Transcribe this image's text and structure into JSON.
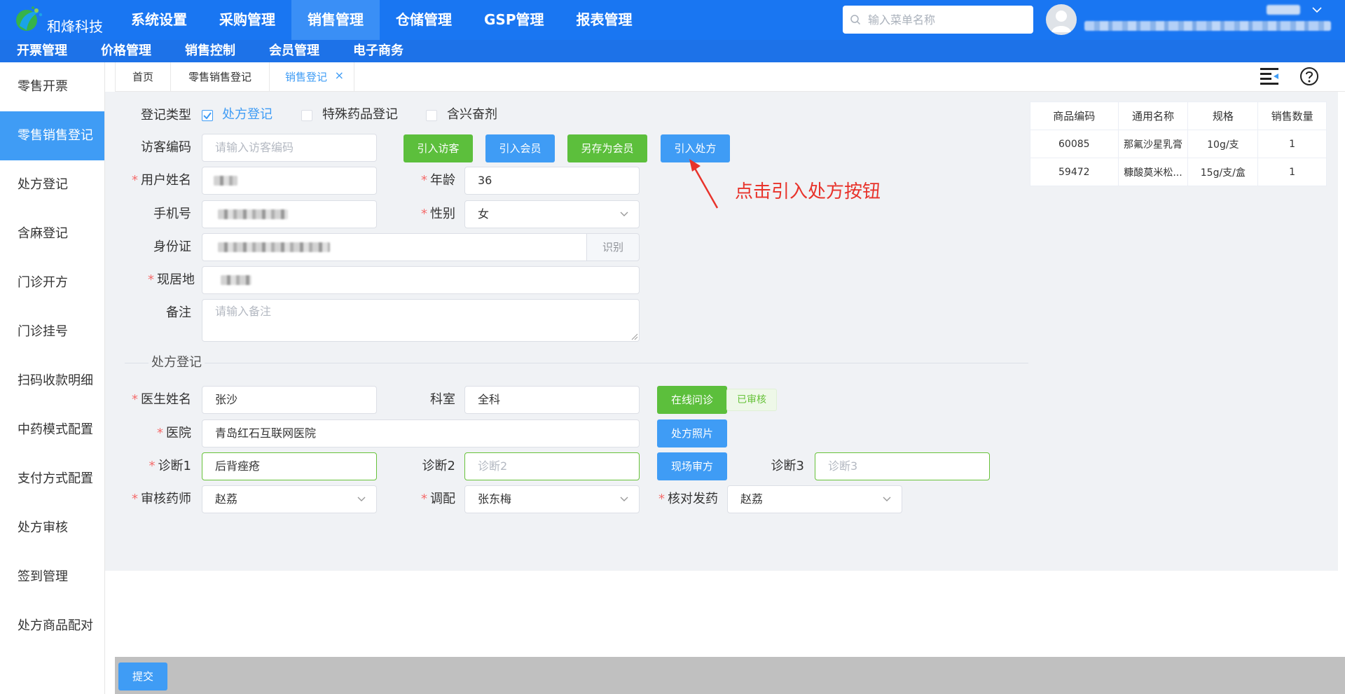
{
  "app": {
    "brand": "和烽科技"
  },
  "top_menu": [
    "系统设置",
    "采购管理",
    "销售管理",
    "仓储管理",
    "GSP管理",
    "报表管理"
  ],
  "search": {
    "placeholder": "输入菜单名称"
  },
  "sub_menu": [
    "开票管理",
    "价格管理",
    "销售控制",
    "会员管理",
    "电子商务"
  ],
  "sidebar": [
    "零售开票",
    "零售销售登记",
    "处方登记",
    "含麻登记",
    "门诊开方",
    "门诊挂号",
    "扫码收款明细",
    "中药模式配置",
    "支付方式配置",
    "处方审核",
    "签到管理",
    "处方商品配对"
  ],
  "tabs": [
    "首页",
    "零售销售登记",
    "销售登记"
  ],
  "tab_close": "×",
  "form": {
    "reg_type_label": "登记类型",
    "options": [
      "处方登记",
      "特殊药品登记",
      "含兴奋剂"
    ],
    "visitor_code_label": "访客编码",
    "visitor_code_placeholder": "请输入访客编码",
    "buttons": {
      "import_visitor": "引入访客",
      "import_member": "引入会员",
      "save_as_member": "另存为会员",
      "import_prescription": "引入处方"
    },
    "user_name_label": "用户姓名",
    "age_label": "年龄",
    "age_value": "36",
    "phone_label": "手机号",
    "gender_label": "性别",
    "gender_value": "女",
    "id_card_label": "身份证",
    "recognize": "识别",
    "address_label": "现居地",
    "remark_label": "备注",
    "remark_placeholder": "请输入备注"
  },
  "prescription": {
    "section_title": "处方登记",
    "doctor_label": "医生姓名",
    "doctor_value": "张沙",
    "dept_label": "科室",
    "dept_value": "全科",
    "online_btn": "在线问诊",
    "audited": "已审核",
    "hospital_label": "医院",
    "hospital_value": "青岛红石互联网医院",
    "photo_btn": "处方照片",
    "diag1_label": "诊断1",
    "diag1_value": "后背痤疮",
    "diag2_label": "诊断2",
    "diag2_placeholder": "诊断2",
    "onsite_btn": "现场审方",
    "diag3_label": "诊断3",
    "diag3_placeholder": "诊断3",
    "pharmacist_label": "审核药师",
    "pharmacist_value": "赵荔",
    "dispense_label": "调配",
    "dispense_value": "张东梅",
    "check_label": "核对发药",
    "check_value": "赵荔"
  },
  "annotation": "点击引入处方按钮",
  "product_table": {
    "headers": [
      "商品编码",
      "通用名称",
      "规格",
      "销售数量"
    ],
    "rows": [
      [
        "60085",
        "那氟沙星乳膏",
        "10g/支",
        "1"
      ],
      [
        "59472",
        "糠酸莫米松...",
        "15g/支/盒",
        "1"
      ]
    ]
  },
  "submit": "提交",
  "colors": {
    "primary": "#1976f2",
    "accent": "#3f9cf5",
    "success": "#5cbf3c",
    "required": "#f56c6c",
    "annotation": "#e8332b"
  }
}
